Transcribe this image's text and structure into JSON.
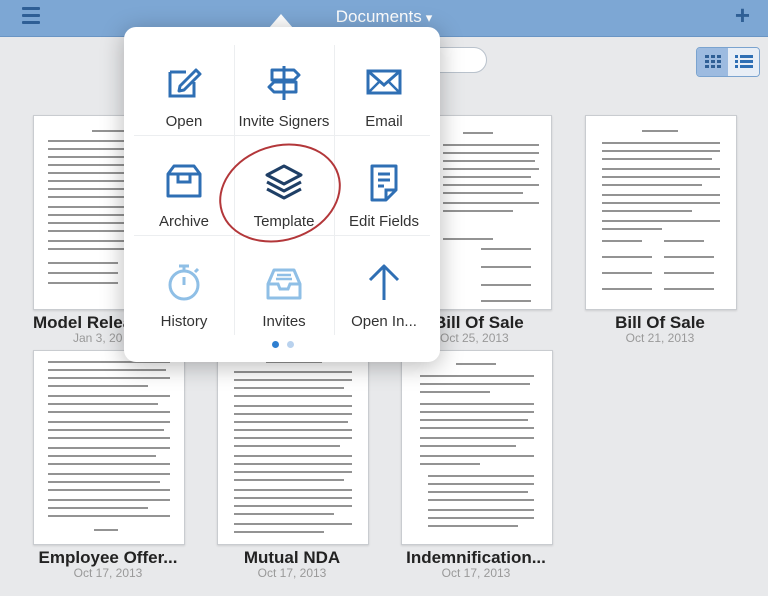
{
  "topbar": {
    "title": "Documents",
    "caret": "▾",
    "add_label": "+"
  },
  "documents": [
    {
      "name": "Model Relea",
      "date": "Jan 3, 20"
    },
    {
      "name": "Bill Of Sale",
      "date": "Oct 25, 2013"
    },
    {
      "name": "Bill Of Sale",
      "date": "Oct 21, 2013"
    },
    {
      "name": "Employee Offer...",
      "date": "Oct 17, 2013"
    },
    {
      "name": "Mutual NDA",
      "date": "Oct 17, 2013"
    },
    {
      "name": "Indemnification...",
      "date": "Oct 17, 2013"
    }
  ],
  "popover": {
    "actions": [
      {
        "label": "Open",
        "icon": "pencil-icon"
      },
      {
        "label": "Invite Signers",
        "icon": "signpost-icon"
      },
      {
        "label": "Email",
        "icon": "envelope-icon"
      },
      {
        "label": "Archive",
        "icon": "archive-box-icon"
      },
      {
        "label": "Template",
        "icon": "layers-icon"
      },
      {
        "label": "Edit Fields",
        "icon": "document-fields-icon"
      },
      {
        "label": "History",
        "icon": "stopwatch-icon"
      },
      {
        "label": "Invites",
        "icon": "inbox-tray-icon"
      },
      {
        "label": "Open In...",
        "icon": "arrow-up-icon"
      }
    ],
    "page_count": 2,
    "current_page": 1
  },
  "colors": {
    "topbar": "#7da7d4",
    "icon_active": "#2f6fb4",
    "icon_template": "#1f3f66",
    "icon_disabled": "#8fbfe6",
    "annotation_circle": "#b3373a"
  }
}
